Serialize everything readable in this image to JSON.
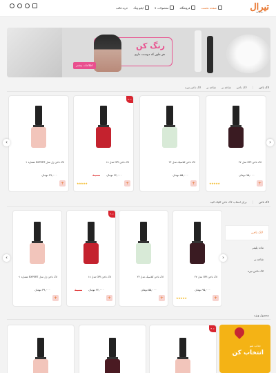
{
  "header": {
    "logo": "تیرال",
    "logo_sub": "TIRAL",
    "nav": [
      {
        "label": "صفحه نخست",
        "active": true
      },
      {
        "label": "فروشگاه",
        "active": false
      },
      {
        "label": "محصولات",
        "active": false
      },
      {
        "label": "ایلیو ونگ",
        "active": false
      },
      {
        "label": "خرید فالب",
        "active": false
      }
    ]
  },
  "banner": {
    "title": "رنگ کن",
    "subtitle": "هر طور که دوست داری",
    "cta": "اطلاعات بیشتر"
  },
  "section1": {
    "label": "لاک ناخن",
    "breadcrumb_sep": "|",
    "hint": "برای انتخاب لاک ناخن کلیک کنید",
    "chips": [
      "لاک ناخن",
      "شاخه بر",
      "شاخه بر",
      "لاک ناخن تیره"
    ],
    "chips_active": [
      false,
      false,
      false,
      false
    ]
  },
  "section2": {
    "label": "لاک ناخن",
    "hint": "برای انتخاب لاک ناخن کلیک کنید"
  },
  "section3": {
    "label": "محصول ویژه"
  },
  "filter": {
    "title": "لاک ناخن",
    "items": [
      "ماده پلیمر",
      "شاخه بر",
      "لاک ناخن تیره"
    ]
  },
  "products_row1": [
    {
      "name": "لاک ناخن OPI مدل ۲۷",
      "price": "۹۵,۰۰۰ تومان",
      "old": "",
      "discount": "",
      "color": "#3a1b22",
      "stars": "★★★★★"
    },
    {
      "name": "لاک ناخن کلاسیک مدل ۲۴",
      "price": "۵۵,۰۰۰ تومان",
      "old": "",
      "discount": "",
      "color": "#d8ead7",
      "stars": ""
    },
    {
      "name": "لاک ناخن OPI مدل ۱۸",
      "price": "۴۲,۰۰۰ تومان",
      "old": "۶۰,۰۰۰",
      "discount": "۳۰٪",
      "color": "#c4222e",
      "stars": "★★★★★"
    },
    {
      "name": "لاک ناخن ژل مدل EXPERT شماره ۰۱",
      "price": "۳۹,۰۰۰ تومان",
      "old": "",
      "discount": "",
      "color": "#f2c5bb",
      "stars": ""
    }
  ],
  "products_row2": [
    {
      "name": "لاک ناخن OPI مدل ۲۷",
      "price": "۹۵,۰۰۰ تومان",
      "old": "",
      "discount": "",
      "color": "#3a1b22",
      "stars": "★★★★★"
    },
    {
      "name": "لاک ناخن کلاسیک مدل ۲۴",
      "price": "۵۵,۰۰۰ تومان",
      "old": "",
      "discount": "",
      "color": "#d8ead7",
      "stars": ""
    },
    {
      "name": "لاک ناخن OPI مدل ۱۸",
      "price": "۴۲,۰۰۰ تومان",
      "old": "۶۰,۰۰۰",
      "discount": "۳۰٪",
      "color": "#c4222e",
      "stars": ""
    },
    {
      "name": "لاک ناخن ژل مدل EXPERT شماره ۰۱",
      "price": "۳۹,۰۰۰ تومان",
      "old": "",
      "discount": "",
      "color": "#f2c5bb",
      "stars": ""
    }
  ],
  "products_row3": [
    {
      "discount": "۳۰٪",
      "color": "#f2c5bb"
    },
    {
      "discount": "",
      "color": "#4a1a22"
    },
    {
      "discount": "",
      "color": "#f2c5bb"
    }
  ],
  "promo": {
    "small": "جذاب شو",
    "big": "انتخاب کن"
  },
  "colors": {
    "accent": "#e8732a",
    "pink": "#e94f8e",
    "sale": "#d8242f"
  }
}
